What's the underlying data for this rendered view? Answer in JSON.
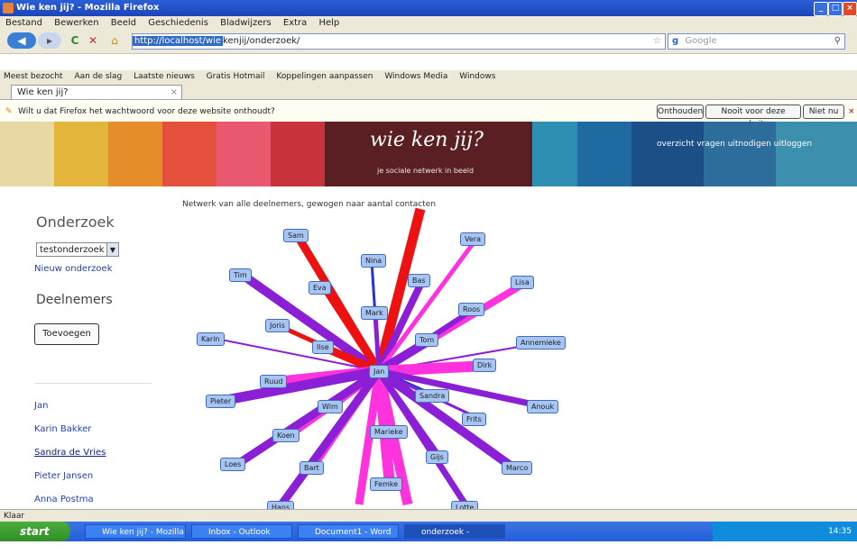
{
  "window": {
    "title": "Wie ken jij? - Mozilla Firefox"
  },
  "menu": [
    "Bestand",
    "Bewerken",
    "Beeld",
    "Geschiedenis",
    "Bladwijzers",
    "Extra",
    "Help"
  ],
  "nav": {
    "url_selected": "http://localhost/wie",
    "url_rest": "kenjij/onderzoek/",
    "search_placeholder": "Google"
  },
  "bookmarks": [
    "Meest bezocht",
    "Aan de slag",
    "Laatste nieuws",
    "Gratis Hotmail",
    "Koppelingen aanpassen",
    "Windows Media",
    "Windows"
  ],
  "tab": {
    "title": "Wie ken jij?"
  },
  "notification": {
    "text": "Wilt u dat Firefox het wachtwoord voor deze website onthoudt?",
    "btn_remember": "Onthouden",
    "btn_never": "Nooit voor deze website",
    "btn_notnow": "Niet nu"
  },
  "banner": {
    "brand": "wie ken jij?",
    "tagline": "je sociale netwerk in beeld",
    "topnav": "overzicht  vragen  uitnodigen  uitloggen"
  },
  "sidebar": {
    "section_title": "Onderzoek",
    "select_value": "testonderzoek",
    "new_link": "Nieuw onderzoek",
    "participants_title": "Deelnemers",
    "add_button": "Toevoegen",
    "people": [
      "Jan",
      "Karin Bakker",
      "Sandra de Vries",
      "Pieter Jansen",
      "Anna Postma"
    ]
  },
  "graph": {
    "caption": "Netwerk van alle deelnemers, gewogen naar aantal contacten",
    "center": "Jan"
  },
  "status": {
    "text": "Klaar"
  },
  "taskbar": {
    "start": "start",
    "tasks": [
      "Wie ken jij? - Mozilla",
      "Inbox - Outlook",
      "Document1 - Word",
      "onderzoek - Verkenner"
    ],
    "clock": "14:35"
  },
  "colors": {
    "red": "#ee1111",
    "magenta": "#ff33dd",
    "purple": "#8a1fd6",
    "blue": "#2233dd"
  }
}
